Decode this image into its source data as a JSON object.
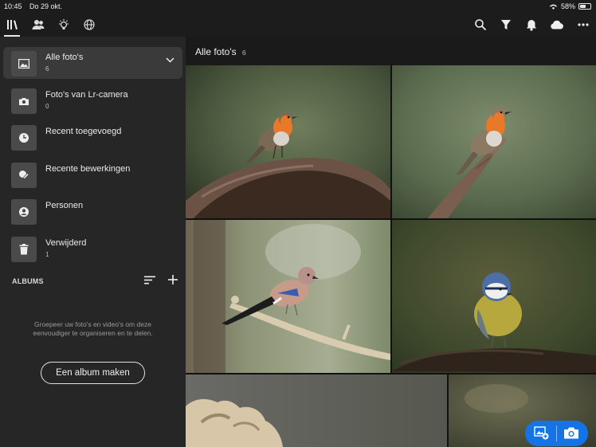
{
  "status": {
    "time": "10:45",
    "date": "Do 29 okt.",
    "battery": "58%",
    "battery_level": 0.58
  },
  "toolbar": {
    "left_icons": [
      "library-icon",
      "people-icon",
      "lightbulb-icon",
      "globe-icon"
    ],
    "right_icons": [
      "search-icon",
      "filter-icon",
      "bell-icon",
      "cloud-icon",
      "more-icon"
    ]
  },
  "sidebar": {
    "items": [
      {
        "label": "Alle foto's",
        "count": "6",
        "icon": "image-icon"
      },
      {
        "label": "Foto's van Lr-camera",
        "count": "0",
        "icon": "camera-icon"
      },
      {
        "label": "Recent toegevoegd",
        "count": "",
        "icon": "clock-icon"
      },
      {
        "label": "Recente bewerkingen",
        "count": "",
        "icon": "edit-icon"
      },
      {
        "label": "Personen",
        "count": "",
        "icon": "person-icon"
      },
      {
        "label": "Verwijderd",
        "count": "1",
        "icon": "trash-icon"
      }
    ],
    "albums_heading": "ALBUMS",
    "albums_empty_text": "Groepeer uw foto's en video's om deze eenvoudiger te organiseren en te delen.",
    "make_album_label": "Een album maken"
  },
  "main": {
    "title": "Alle foto's",
    "count": "6"
  },
  "photos": [
    {
      "subject": "robin on curved branch"
    },
    {
      "subject": "robin on twig"
    },
    {
      "subject": "jay on branch"
    },
    {
      "subject": "blue tit on log"
    },
    {
      "subject": "fluffy animal closeup"
    },
    {
      "subject": "blurred green background"
    }
  ],
  "colors": {
    "accent": "#1473e6",
    "sidebar_bg": "#262626",
    "app_bg": "#1c1c1c"
  }
}
